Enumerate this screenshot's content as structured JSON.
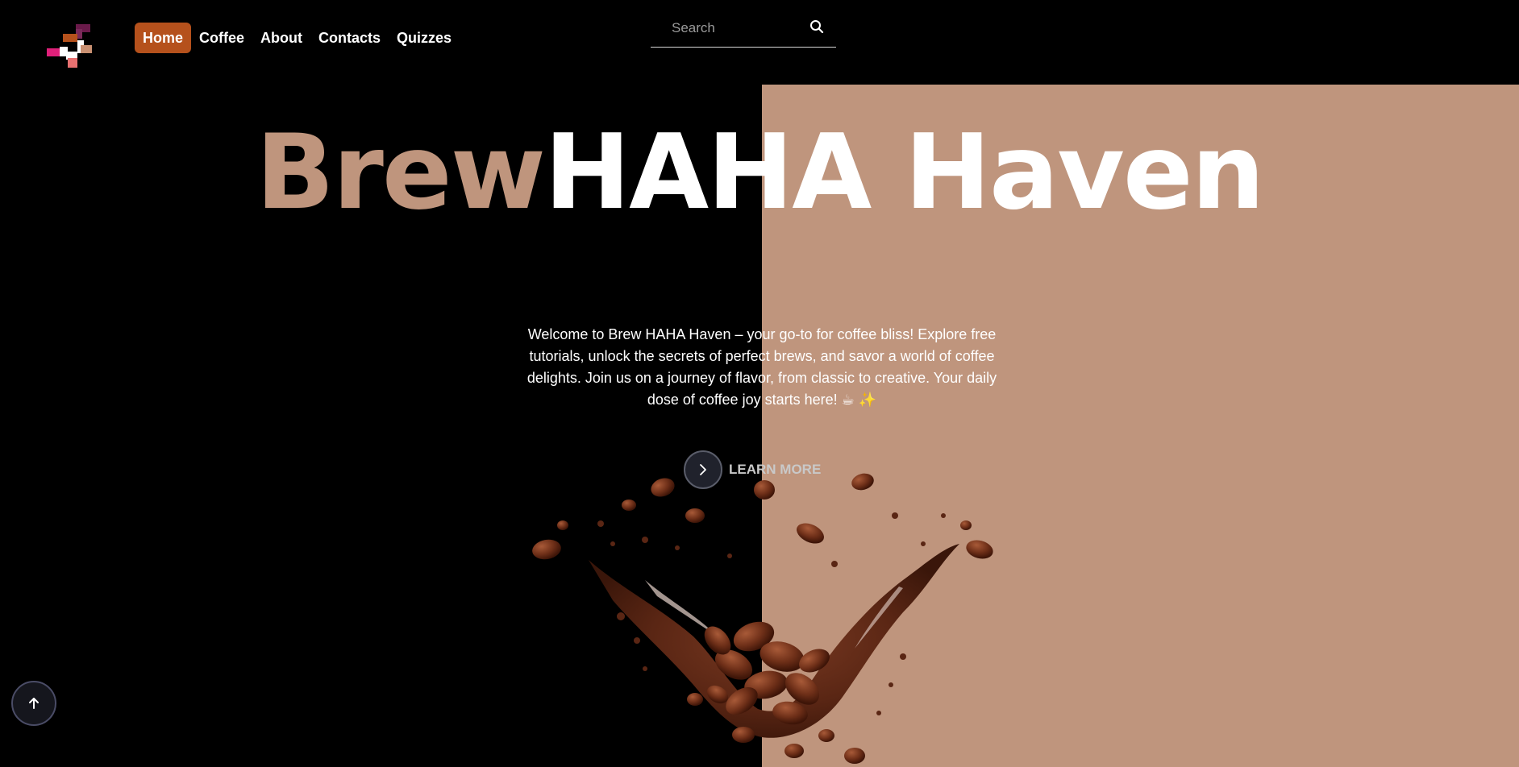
{
  "nav": {
    "items": [
      {
        "label": "Home",
        "active": true
      },
      {
        "label": "Coffee",
        "active": false
      },
      {
        "label": "About",
        "active": false
      },
      {
        "label": "Contacts",
        "active": false
      },
      {
        "label": "Quizzes",
        "active": false
      }
    ]
  },
  "search": {
    "placeholder": "Search",
    "icon": "search-icon"
  },
  "hero": {
    "title_brew": "Brew",
    "title_rest": "HAHA Haven",
    "intro": "Welcome to Brew HAHA Haven – your go-to for coffee bliss! Explore free tutorials, unlock the secrets of perfect brews, and savor a world of coffee delights. Join us on a journey of flavor, from classic to creative. Your daily dose of coffee joy starts here! ☕ ✨",
    "learn_more": "LEARN MORE"
  },
  "colors": {
    "background": "#000000",
    "accent_panel": "#bf957d",
    "nav_active": "#b5511c"
  },
  "icons": {
    "logo": "brand-logo",
    "learn_more": "chevron-right-icon",
    "scroll_top": "arrow-up-icon"
  }
}
